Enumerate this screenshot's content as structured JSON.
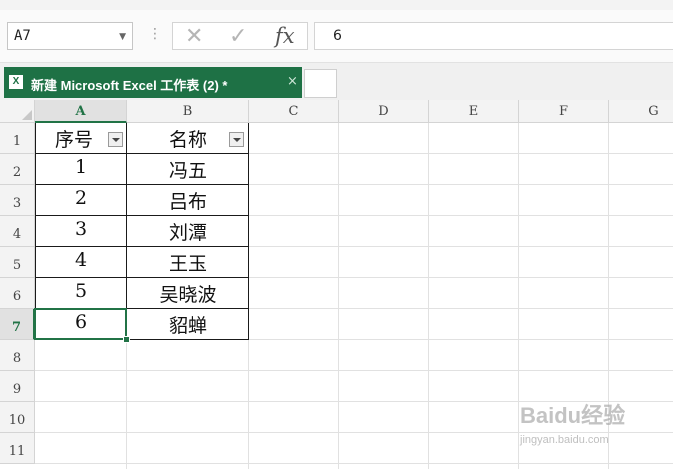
{
  "formula_bar": {
    "name_box": "A7",
    "cancel_icon": "✕",
    "enter_icon": "✓",
    "fx_label": "fx",
    "content": "6"
  },
  "workbook_tab": {
    "title": "新建 Microsoft Excel 工作表 (2) *",
    "close_icon": "×"
  },
  "sheet": {
    "columns": [
      "A",
      "B",
      "C",
      "D",
      "E",
      "F",
      "G"
    ],
    "rows": [
      "1",
      "2",
      "3",
      "4",
      "5",
      "6",
      "7",
      "8",
      "9",
      "10",
      "11"
    ],
    "selected_cell": "A7",
    "table": {
      "headers": [
        "序号",
        "名称"
      ],
      "rows": [
        [
          "1",
          "冯五"
        ],
        [
          "2",
          "吕布"
        ],
        [
          "3",
          "刘潭"
        ],
        [
          "4",
          "王玉"
        ],
        [
          "5",
          "吴晓波"
        ],
        [
          "6",
          "貂蝉"
        ]
      ]
    }
  },
  "watermark": {
    "line1": "Baidu经验",
    "line2": "jingyan.baidu.com"
  }
}
